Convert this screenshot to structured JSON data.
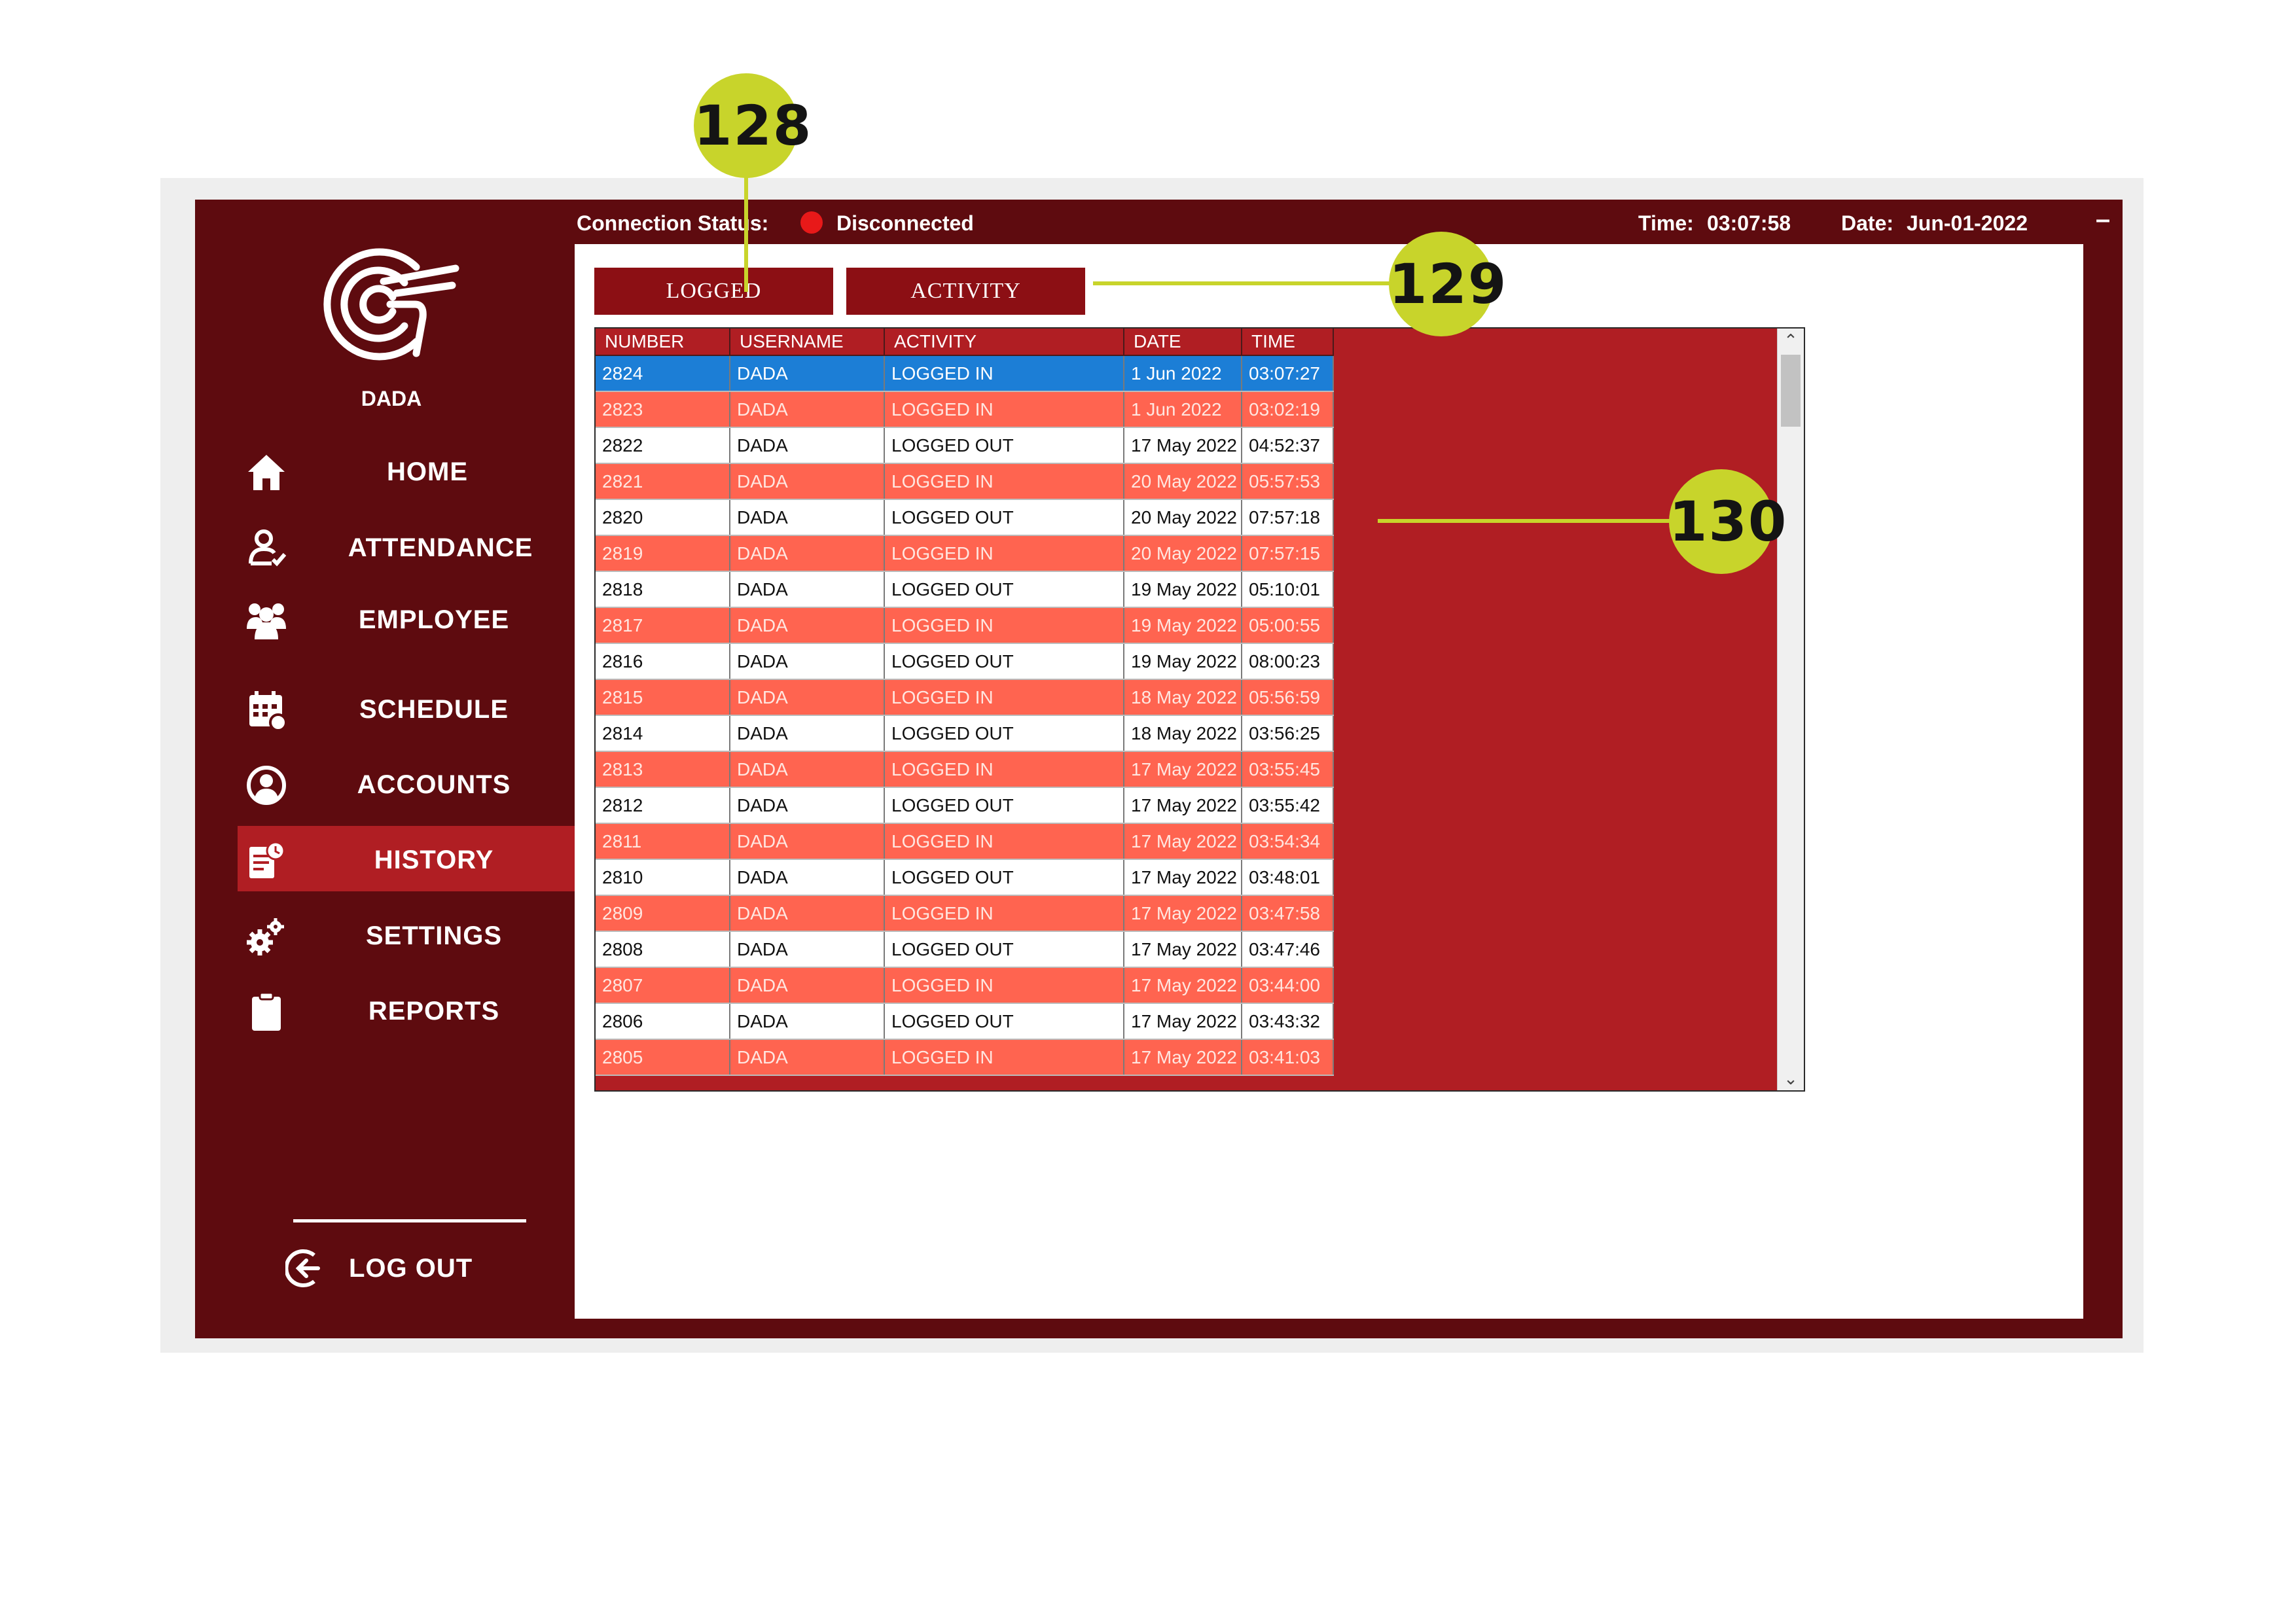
{
  "status_bar": {
    "connection_label": "Connection Status:",
    "connection_value": "Disconnected",
    "time_label": "Time:",
    "time_value": "03:07:58",
    "date_label": "Date:",
    "date_value": "Jun-01-2022",
    "minimize_label": "–",
    "status_color": "#e81919"
  },
  "sidebar": {
    "username": "DADA",
    "items": [
      {
        "label": "HOME",
        "icon": "home-icon"
      },
      {
        "label": "ATTENDANCE",
        "icon": "user-check-icon"
      },
      {
        "label": "EMPLOYEE",
        "icon": "users-icon"
      },
      {
        "label": "SCHEDULE",
        "icon": "calendar-icon"
      },
      {
        "label": "ACCOUNTS",
        "icon": "account-circle-icon"
      },
      {
        "label": "HISTORY",
        "icon": "history-icon",
        "active": true
      },
      {
        "label": "SETTINGS",
        "icon": "gears-icon"
      },
      {
        "label": "REPORTS",
        "icon": "clipboard-icon"
      }
    ],
    "logout_label": "LOG OUT"
  },
  "tabs": {
    "logged_label": "LOGGED",
    "activity_label": "ACTIVITY"
  },
  "table": {
    "columns": [
      "NUMBER",
      "USERNAME",
      "ACTIVITY",
      "DATE",
      "TIME"
    ],
    "rows": [
      [
        "2824",
        "DADA",
        "LOGGED IN",
        "1 Jun 2022",
        "03:07:27"
      ],
      [
        "2823",
        "DADA",
        "LOGGED IN",
        "1 Jun 2022",
        "03:02:19"
      ],
      [
        "2822",
        "DADA",
        "LOGGED OUT",
        "17 May 2022",
        "04:52:37"
      ],
      [
        "2821",
        "DADA",
        "LOGGED IN",
        "20 May 2022",
        "05:57:53"
      ],
      [
        "2820",
        "DADA",
        "LOGGED OUT",
        "20 May 2022",
        "07:57:18"
      ],
      [
        "2819",
        "DADA",
        "LOGGED IN",
        "20 May 2022",
        "07:57:15"
      ],
      [
        "2818",
        "DADA",
        "LOGGED OUT",
        "19 May 2022",
        "05:10:01"
      ],
      [
        "2817",
        "DADA",
        "LOGGED IN",
        "19 May 2022",
        "05:00:55"
      ],
      [
        "2816",
        "DADA",
        "LOGGED OUT",
        "19 May 2022",
        "08:00:23"
      ],
      [
        "2815",
        "DADA",
        "LOGGED IN",
        "18 May 2022",
        "05:56:59"
      ],
      [
        "2814",
        "DADA",
        "LOGGED OUT",
        "18 May 2022",
        "03:56:25"
      ],
      [
        "2813",
        "DADA",
        "LOGGED IN",
        "17 May 2022",
        "03:55:45"
      ],
      [
        "2812",
        "DADA",
        "LOGGED OUT",
        "17 May 2022",
        "03:55:42"
      ],
      [
        "2811",
        "DADA",
        "LOGGED IN",
        "17 May 2022",
        "03:54:34"
      ],
      [
        "2810",
        "DADA",
        "LOGGED OUT",
        "17 May 2022",
        "03:48:01"
      ],
      [
        "2809",
        "DADA",
        "LOGGED IN",
        "17 May 2022",
        "03:47:58"
      ],
      [
        "2808",
        "DADA",
        "LOGGED OUT",
        "17 May 2022",
        "03:47:46"
      ],
      [
        "2807",
        "DADA",
        "LOGGED IN",
        "17 May 2022",
        "03:44:00"
      ],
      [
        "2806",
        "DADA",
        "LOGGED OUT",
        "17 May 2022",
        "03:43:32"
      ],
      [
        "2805",
        "DADA",
        "LOGGED IN",
        "17 May 2022",
        "03:41:03"
      ]
    ],
    "selected_row": 0
  },
  "callouts": {
    "c128": "128",
    "c129": "129",
    "c130": "130"
  },
  "colors": {
    "app_background": "#5e0b0f",
    "active_nav": "#b01e23",
    "tab_button": "#8c0f14",
    "row_alt": "#ff6450",
    "row_selected": "#1c7ed6",
    "callout": "#c8d42b"
  }
}
